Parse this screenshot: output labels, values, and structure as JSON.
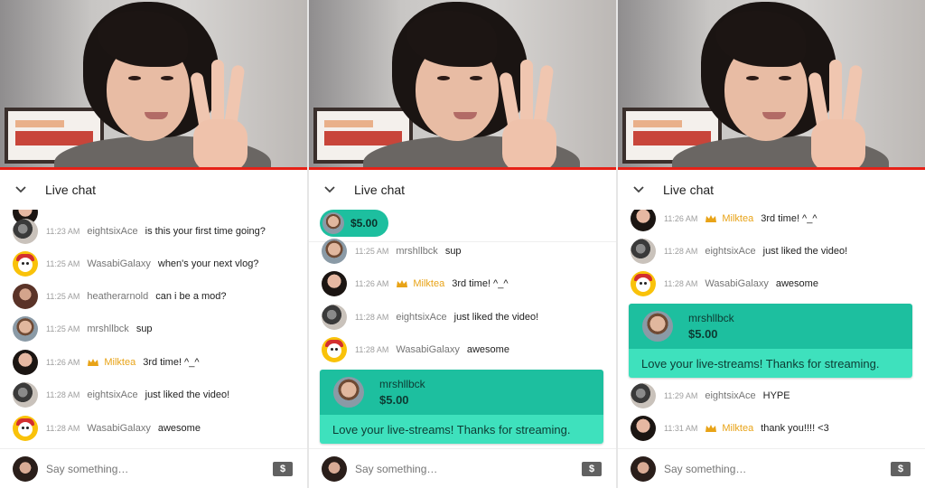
{
  "colors": {
    "accent_superchat": "#1dbf9f",
    "superchat_body": "#3ee1bd",
    "moderator": "#e8a317",
    "progress": "#e62117"
  },
  "panels": [
    {
      "header": {
        "title": "Live chat",
        "collapse_icon": "chevron-down-icon"
      },
      "messages": [
        {
          "time": "11:23 AM",
          "author": "eightsixAce",
          "text": "is this your first time going?",
          "avatar": "moto"
        },
        {
          "time": "11:25 AM",
          "author": "WasabiGalaxy",
          "text": "when's your next vlog?",
          "avatar": "yellow"
        },
        {
          "time": "11:25 AM",
          "author": "heatherarnold",
          "text": "can i be a mod?",
          "avatar": "hg"
        },
        {
          "time": "11:25 AM",
          "author": "mrshllbck",
          "text": "sup",
          "avatar": "man"
        },
        {
          "time": "11:26 AM",
          "author": "Milktea",
          "text": "3rd time! ^_^",
          "avatar": "dark",
          "moderator": true
        },
        {
          "time": "11:28 AM",
          "author": "eightsixAce",
          "text": "just liked the video!",
          "avatar": "moto"
        },
        {
          "time": "11:28 AM",
          "author": "WasabiGalaxy",
          "text": "awesome",
          "avatar": "yellow"
        }
      ],
      "input": {
        "placeholder": "Say something…",
        "dollar_label": "$"
      }
    },
    {
      "header": {
        "title": "Live chat",
        "collapse_icon": "chevron-down-icon"
      },
      "pinned": {
        "amount": "$5.00"
      },
      "messages": [
        {
          "time": "11:25 AM",
          "author": "mrshllbck",
          "text": "sup",
          "avatar": "man"
        },
        {
          "time": "11:26 AM",
          "author": "Milktea",
          "text": "3rd time! ^_^",
          "avatar": "dark",
          "moderator": true
        },
        {
          "time": "11:28 AM",
          "author": "eightsixAce",
          "text": "just liked the video!",
          "avatar": "moto"
        },
        {
          "time": "11:28 AM",
          "author": "WasabiGalaxy",
          "text": "awesome",
          "avatar": "yellow"
        }
      ],
      "superchat": {
        "name": "mrshllbck",
        "amount": "$5.00",
        "message": "Love your live-streams! Thanks for streaming."
      },
      "input": {
        "placeholder": "Say something…",
        "dollar_label": "$"
      }
    },
    {
      "header": {
        "title": "Live chat",
        "collapse_icon": "chevron-down-icon"
      },
      "messages_top": [
        {
          "time": "11:26 AM",
          "author": "Milktea",
          "text": "3rd time! ^_^",
          "avatar": "dark",
          "moderator": true
        },
        {
          "time": "11:28 AM",
          "author": "eightsixAce",
          "text": "just liked the video!",
          "avatar": "moto"
        },
        {
          "time": "11:28 AM",
          "author": "WasabiGalaxy",
          "text": "awesome",
          "avatar": "yellow"
        }
      ],
      "superchat": {
        "name": "mrshllbck",
        "amount": "$5.00",
        "message": "Love your live-streams! Thanks for streaming."
      },
      "messages_bottom": [
        {
          "time": "11:29 AM",
          "author": "eightsixAce",
          "text": "HYPE",
          "avatar": "moto"
        },
        {
          "time": "11:31 AM",
          "author": "Milktea",
          "text": "thank you!!!! <3",
          "avatar": "dark",
          "moderator": true
        }
      ],
      "input": {
        "placeholder": "Say something…",
        "dollar_label": "$"
      }
    }
  ]
}
